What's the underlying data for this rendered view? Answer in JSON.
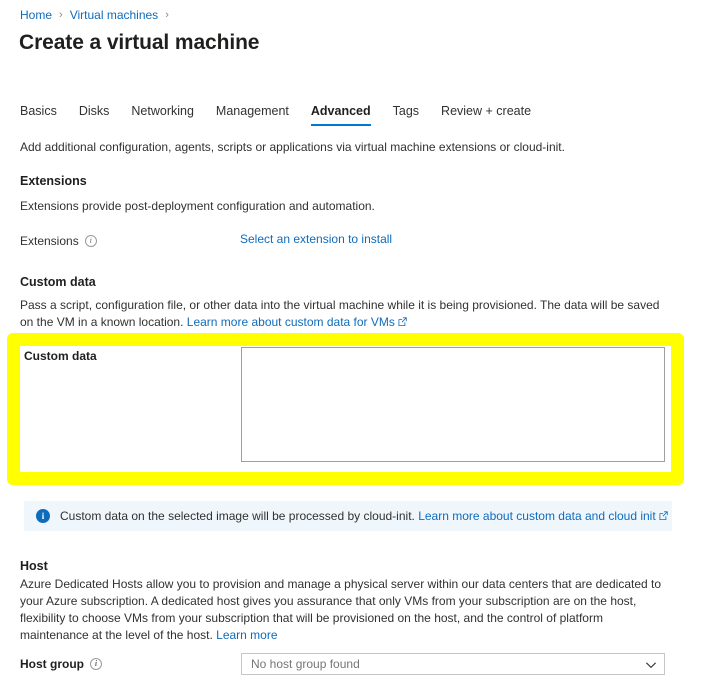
{
  "breadcrumb": {
    "items": [
      {
        "label": "Home"
      },
      {
        "label": "Virtual machines"
      }
    ],
    "separator": "›"
  },
  "page": {
    "title": "Create a virtual machine"
  },
  "tabs": [
    {
      "label": "Basics",
      "active": false
    },
    {
      "label": "Disks",
      "active": false
    },
    {
      "label": "Networking",
      "active": false
    },
    {
      "label": "Management",
      "active": false
    },
    {
      "label": "Advanced",
      "active": true
    },
    {
      "label": "Tags",
      "active": false
    },
    {
      "label": "Review + create",
      "active": false
    }
  ],
  "intro": {
    "text": "Add additional configuration, agents, scripts or applications via virtual machine extensions or cloud-init."
  },
  "extensions": {
    "heading": "Extensions",
    "description": "Extensions provide post-deployment configuration and automation.",
    "field_label": "Extensions",
    "install_link": "Select an extension to install"
  },
  "custom_data": {
    "heading": "Custom data",
    "description_part1": "Pass a script, configuration file, or other data into the virtual machine while it is being provisioned. The data will be saved on the VM in a known location.",
    "learn_more_link": "Learn more about custom data for VMs",
    "field_label": "Custom data",
    "textarea_value": "",
    "textarea_placeholder": "",
    "highlight_color": "#ffff00"
  },
  "info_banner": {
    "message": "Custom data on the selected image will be processed by cloud-init.",
    "link": "Learn more about custom data and cloud init",
    "background": "#eff6fc",
    "icon": "info-icon"
  },
  "host": {
    "heading": "Host",
    "description": "Azure Dedicated Hosts allow you to provision and manage a physical server within our data centers that are dedicated to your Azure subscription. A dedicated host gives you assurance that only VMs from your subscription are on the host, flexibility to choose VMs from your subscription that will be provisioned on the host, and the control of platform maintenance at the level of the host.",
    "learn_more_link": "Learn more",
    "host_group": {
      "label": "Host group",
      "value": "No host group found"
    }
  },
  "colors": {
    "link": "#0f6cbd",
    "accent": "#0078d4",
    "text": "#323130",
    "highlight": "#ffff00"
  }
}
